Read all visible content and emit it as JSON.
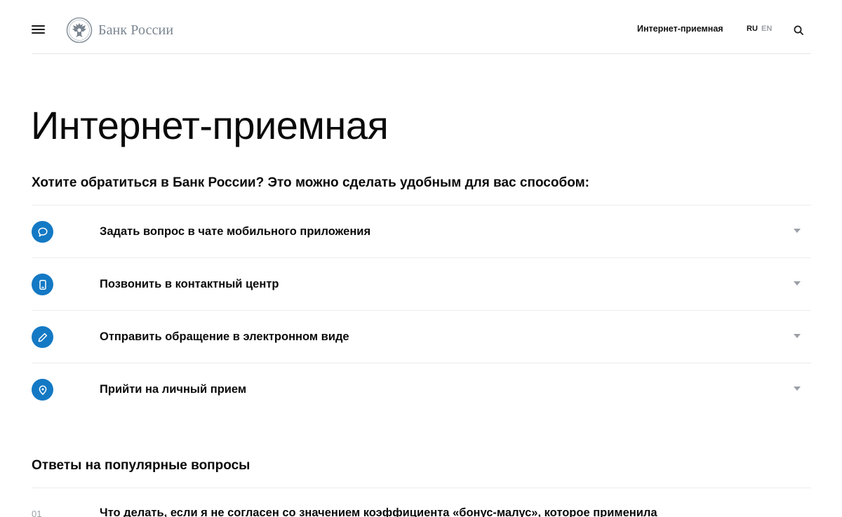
{
  "header": {
    "logo_text": "Банк России",
    "nav_link": "Интернет-приемная",
    "lang_ru": "RU",
    "lang_en": "EN",
    "icons": {
      "menu": "burger-icon",
      "logo": "eagle-emblem-icon",
      "search": "search-icon"
    }
  },
  "main": {
    "title": "Интернет-приемная",
    "subtitle": "Хотите обратиться в Банк России? Это можно сделать удобным для вас способом:",
    "accent_color": "#1479c4",
    "options": [
      {
        "label": "Задать вопрос в чате мобильного приложения",
        "icon": "chat-bubble-icon"
      },
      {
        "label": "Позвонить в контактный центр",
        "icon": "phone-icon"
      },
      {
        "label": "Отправить обращение в электронном виде",
        "icon": "pencil-icon"
      },
      {
        "label": "Прийти на личный прием",
        "icon": "location-pin-icon"
      }
    ]
  },
  "faq": {
    "title": "Ответы на популярные вопросы",
    "items": [
      {
        "number": "01",
        "question": "Что делать, если я не согласен со значением коэффициента «бонус-малус», которое применила"
      }
    ]
  }
}
